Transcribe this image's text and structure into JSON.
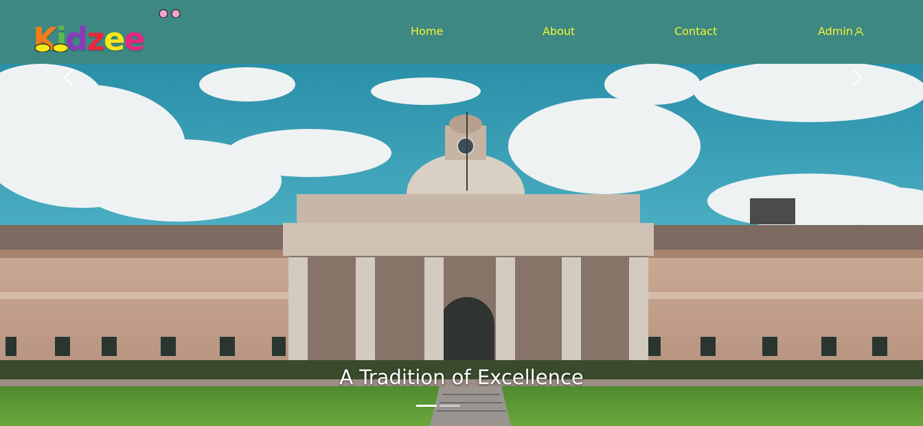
{
  "brand": {
    "logo_letters": [
      "K",
      "i",
      "d",
      "z",
      "e",
      "e"
    ],
    "logo_colors": [
      "#f07d1a",
      "#5cb94d",
      "#8a3ab9",
      "#e8283c",
      "#f7e81a",
      "#e6267f"
    ]
  },
  "nav": {
    "items": [
      {
        "label": "Home"
      },
      {
        "label": "About"
      },
      {
        "label": "Contact"
      },
      {
        "label": "Admin",
        "icon": "user-icon"
      }
    ]
  },
  "carousel": {
    "slides": [
      {
        "caption": "A Tradition of Excellence"
      }
    ],
    "active_index": 0,
    "indicator_count": 2,
    "prev_icon": "chevron-left-icon",
    "next_icon": "chevron-right-icon"
  },
  "colors": {
    "navbar_bg": "#3d8883",
    "nav_text": "#f4f530"
  }
}
